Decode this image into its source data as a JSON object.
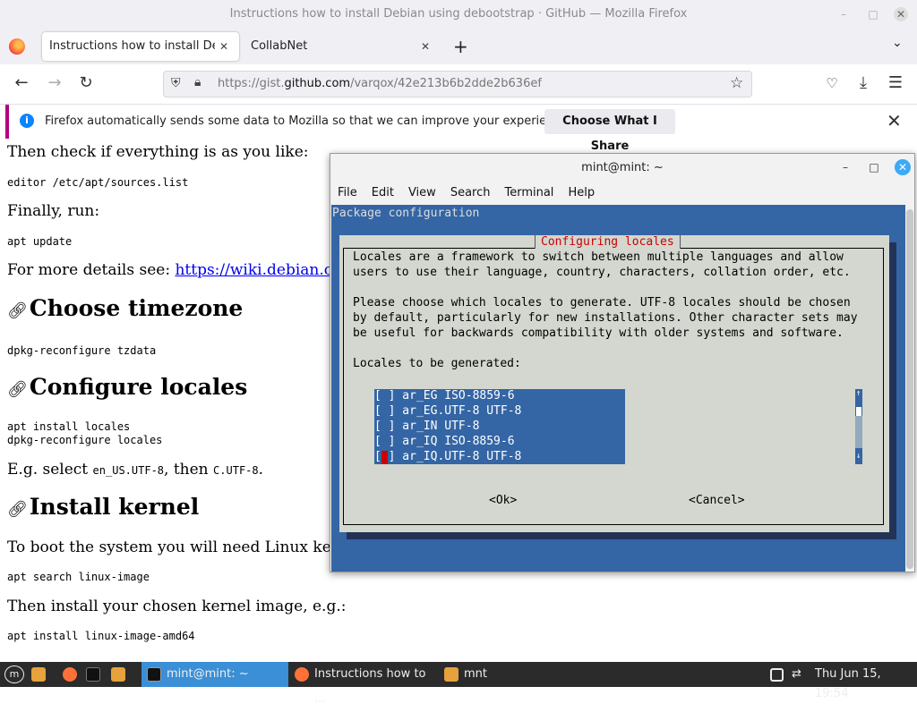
{
  "browser": {
    "window_title": "Instructions how to install Debian using debootstrap · GitHub — Mozilla Firefox",
    "tabs": [
      {
        "label": "Instructions how to install Debi",
        "active": true
      },
      {
        "label": "CollabNet",
        "active": false
      }
    ],
    "url_prefix": "https://gist.",
    "url_domain": "github.com",
    "url_suffix": "/varqox/42e213b6b2dde2b636ef",
    "notification": {
      "message": "Firefox automatically sends some data to Mozilla so that we can improve your experience.",
      "button": "Choose What I Share"
    }
  },
  "page": {
    "p1": "Then check if everything is as you like:",
    "code1": "editor /etc/apt/sources.list",
    "p2": "Finally, run:",
    "code2": "apt update",
    "p3_text": "For more details see: ",
    "p3_link": "https://wiki.debian.org",
    "h_timezone": "Choose timezone",
    "code3": "dpkg-reconfigure tzdata",
    "h_locales": "Configure locales",
    "code4a": "apt install locales",
    "code4b": "dpkg-reconfigure locales",
    "p4_a": "E.g. select ",
    "p4_code1": "en_US.UTF-8",
    "p4_b": ", then ",
    "p4_code2": "C.UTF-8",
    "p4_c": ".",
    "h_kernel": "Install kernel",
    "p5": "To boot the system you will need Linux kerne",
    "code5": "apt search linux-image",
    "p6": "Then install your chosen kernel image, e.g.:",
    "code6": "apt install linux-image-amd64",
    "link_icon": "link-icon"
  },
  "terminal": {
    "title": "mint@mint: ~",
    "menu": [
      "File",
      "Edit",
      "View",
      "Search",
      "Terminal",
      "Help"
    ],
    "header": "Package configuration",
    "dialog_title": "Configuring locales",
    "lines": [
      "Locales are a framework to switch between multiple languages and allow",
      "users to use their language, country, characters, collation order, etc.",
      "",
      "Please choose which locales to generate. UTF-8 locales should be chosen",
      "by default, particularly for new installations. Other character sets may",
      "be useful for backwards compatibility with older systems and software.",
      "",
      "Locales to be generated:"
    ],
    "locales": [
      "[ ] ar_EG ISO-8859-6",
      "[ ] ar_EG.UTF-8 UTF-8",
      "[ ] ar_IN UTF-8",
      "[ ] ar_IQ ISO-8859-6",
      "[ ] ar_IQ.UTF-8 UTF-8"
    ],
    "ok": "<Ok>",
    "cancel": "<Cancel>"
  },
  "taskbar": {
    "tasks": [
      {
        "label": "mint@mint: ~",
        "active": true
      },
      {
        "label": "Instructions how to ...",
        "active": false
      },
      {
        "label": "mnt",
        "active": false
      }
    ],
    "clock": "Thu Jun 15, 19:54"
  }
}
